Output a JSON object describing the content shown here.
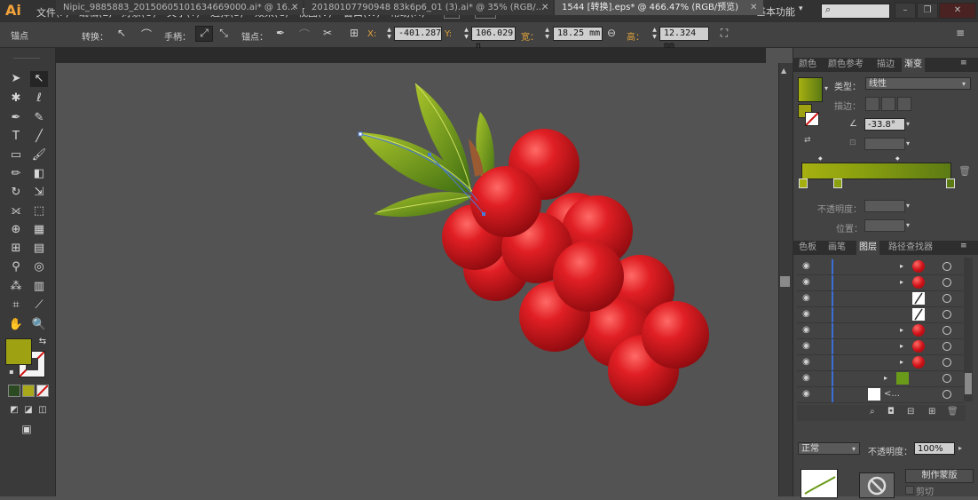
{
  "app": {
    "logo": "Ai",
    "menu": [
      "文件(F)",
      "编辑(E)",
      "对象(O)",
      "文字(T)",
      "选择(S)",
      "效果(C)",
      "视图(V)",
      "窗口(W)",
      "帮助(H)"
    ],
    "workspace": "基本功能",
    "workspace_arrow": "▾",
    "search_icon": "⌕"
  },
  "window_controls": {
    "minimize": "–",
    "restore": "❐",
    "close": "✕"
  },
  "control_bar": {
    "tool_name": "锚点",
    "convert_label": "转换：",
    "handle_label": "手柄：",
    "anchor_label": "锚点：",
    "x_label": "X:",
    "x_value": "-401.287",
    "y_label": "Y:",
    "y_value": "106.029 n",
    "w_label": "宽：",
    "w_value": "18.25 mm",
    "h_label": "高：",
    "h_value": "12.324 mm",
    "options_icon": "≡"
  },
  "tabs": [
    {
      "label": "Nipic_9885883_20150605101634669000.ai* @ 16...",
      "close": "✕"
    },
    {
      "label": "20180107790948 83k6p6_01 (3).ai* @ 35% (RGB/...",
      "close": "✕"
    },
    {
      "label": "1544 [转换].eps* @ 466.47% (RGB/预览)",
      "close": "✕"
    }
  ],
  "panels": {
    "top_tabs": [
      "颜色",
      "颜色参考",
      "描边",
      "渐变"
    ],
    "gradient": {
      "type_label": "类型：",
      "type_value": "线性",
      "stroke_label": "描边：",
      "angle_value": "-33.8°",
      "opacity_label": "不透明度：",
      "position_label": "位置：",
      "start_color": "#a6b010",
      "end_color": "#5c7a14"
    },
    "bottom_tabs": [
      "色板",
      "画笔",
      "图层",
      "路径查找器"
    ],
    "layers": [
      {
        "kind": "berry",
        "expand": "▸"
      },
      {
        "kind": "berry",
        "expand": "▸"
      },
      {
        "kind": "stroke",
        "expand": ""
      },
      {
        "kind": "stroke",
        "expand": ""
      },
      {
        "kind": "berry",
        "expand": "▸"
      },
      {
        "kind": "berry",
        "expand": "▸"
      },
      {
        "kind": "berry",
        "expand": "▸"
      },
      {
        "kind": "leaf",
        "expand": "▸"
      },
      {
        "kind": "blank",
        "expand": "",
        "label": "<..."
      }
    ],
    "transparency": {
      "blend_mode": "正常",
      "opacity_label": "不透明度：",
      "opacity_value": "100%",
      "mask_button": "制作蒙版",
      "clip_label": "剪切"
    }
  },
  "colors": {
    "fill": "#9ea112",
    "berry": "#d0141a",
    "leaf": "#6a9a1a",
    "stem": "#9a5a32"
  }
}
